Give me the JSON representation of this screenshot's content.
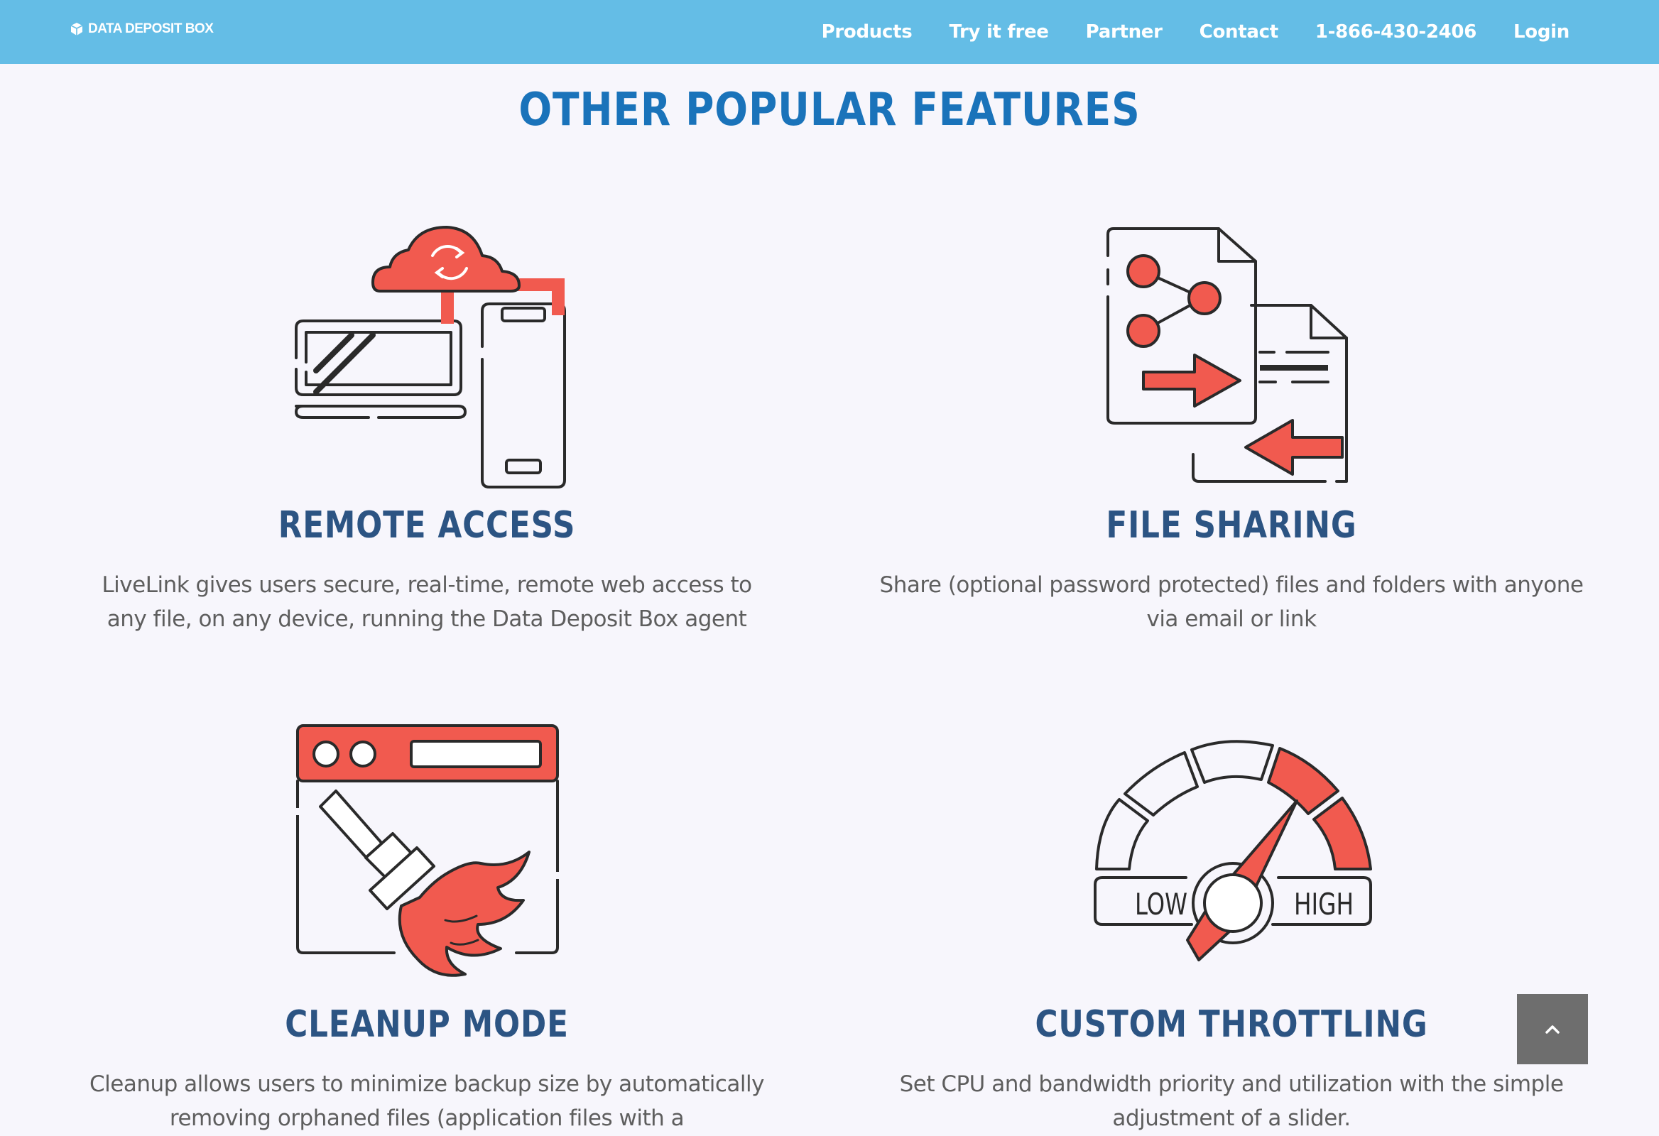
{
  "header": {
    "brand": "DATA DEPOSIT BOX",
    "nav": [
      "Products",
      "Try it free",
      "Partner",
      "Contact",
      "1-866-430-2406",
      "Login"
    ]
  },
  "section_title": "OTHER POPULAR FEATURES",
  "features": [
    {
      "title": "REMOTE ACCESS",
      "description": "LiveLink gives users secure, real-time, remote web access to any file, on any device, running the Data Deposit Box agent",
      "icon": "remote-access-icon"
    },
    {
      "title": "FILE SHARING",
      "description": "Share (optional password protected) files and folders with anyone via email or link",
      "icon": "file-sharing-icon"
    },
    {
      "title": "CLEANUP MODE",
      "description": "Cleanup allows users to minimize backup size by automatically removing orphaned files (application files with a",
      "icon": "cleanup-brush-icon"
    },
    {
      "title": "CUSTOM THROTTLING",
      "description": "Set CPU and bandwidth priority and utilization with the simple adjustment of a slider.",
      "icon": "throttle-gauge-icon",
      "gauge_low": "LOW",
      "gauge_high": "HIGH"
    }
  ],
  "colors": {
    "nav_bg": "#64bde6",
    "title": "#1a73ba",
    "feature_title": "#2c5483",
    "accent": "#f15a4f",
    "line": "#2a2a2a"
  },
  "scroll_top_icon": "chevron-up-icon"
}
